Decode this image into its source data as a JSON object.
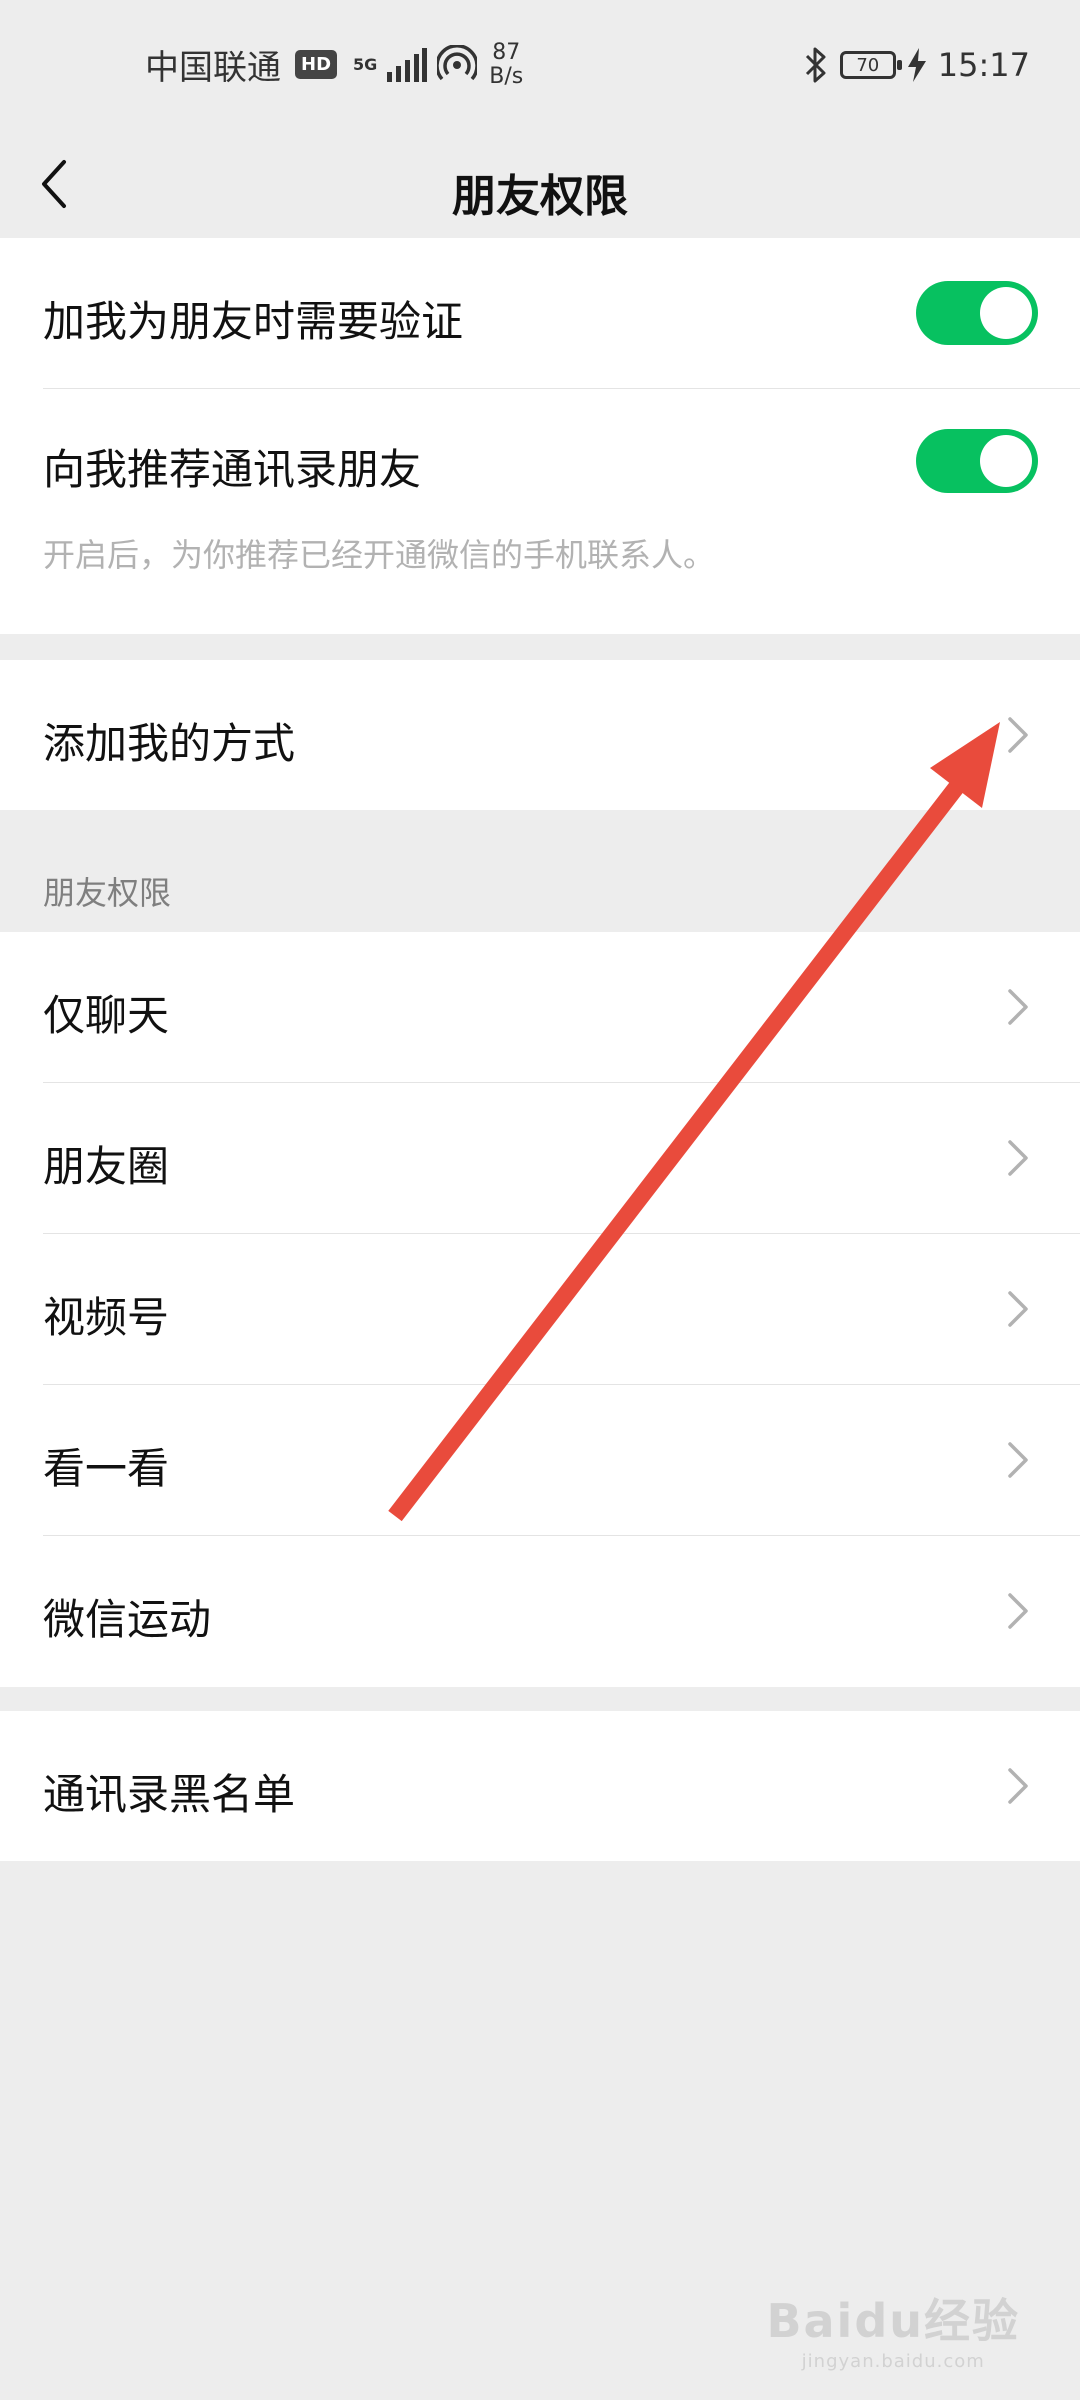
{
  "status_bar": {
    "carrier": "中国联通",
    "hd_badge": "HD",
    "network": "5G",
    "speed_value": "87",
    "speed_unit": "B/s",
    "battery": "70",
    "time": "15:17"
  },
  "nav": {
    "title": "朋友权限",
    "back_icon": "chevron-left-icon"
  },
  "verification_group": {
    "items": [
      {
        "label": "加我为朋友时需要验证",
        "toggle_on": true
      },
      {
        "label": "向我推荐通讯录朋友",
        "toggle_on": true,
        "hint": "开启后，为你推荐已经开通微信的手机联系人。"
      }
    ]
  },
  "add_method": {
    "label": "添加我的方式"
  },
  "permissions": {
    "header": "朋友权限",
    "items": [
      {
        "label": "仅聊天"
      },
      {
        "label": "朋友圈"
      },
      {
        "label": "视频号"
      },
      {
        "label": "看一看"
      },
      {
        "label": "微信运动"
      }
    ]
  },
  "blacklist": {
    "label": "通讯录黑名单"
  },
  "watermark": {
    "logo": "Baidu经验",
    "url": "jingyan.baidu.com"
  },
  "colors": {
    "toggle_on": "#07c160",
    "annotation_arrow": "#e94b3c",
    "background": "#ededed"
  }
}
